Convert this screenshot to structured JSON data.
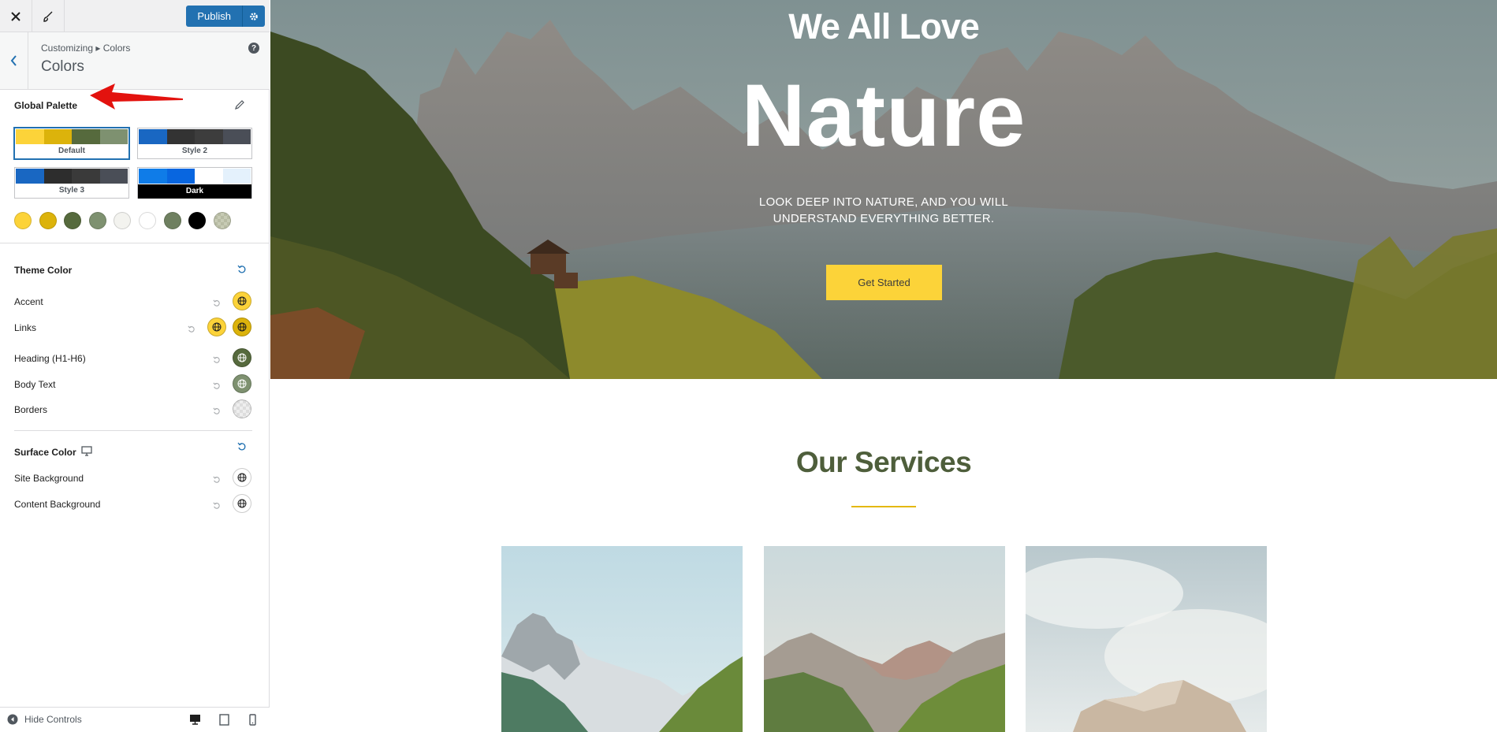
{
  "sidebar": {
    "close_icon": "close-icon",
    "brush_icon": "brush-icon",
    "publish_label": "Publish",
    "breadcrumb": "Customizing ▸ Colors",
    "section_title": "Colors",
    "help_glyph": "?",
    "global_palette_label": "Global Palette",
    "palettes": [
      {
        "name": "Default",
        "colors": [
          "#fcd339",
          "#dcb30b",
          "#566a3d",
          "#7e9170"
        ],
        "active": true
      },
      {
        "name": "Style 2",
        "colors": [
          "#1967c2",
          "#333333",
          "#3d3d3d",
          "#4a4e57"
        ],
        "active": false
      },
      {
        "name": "Style 3",
        "colors": [
          "#1967c2",
          "#2d2d2d",
          "#3a3a3a",
          "#4a4e57"
        ],
        "active": false
      },
      {
        "name": "Dark",
        "colors": [
          "#0f7ce8",
          "#0866e0",
          "#ffffff",
          "#e4f1fc"
        ],
        "active": false
      }
    ],
    "swatches": [
      "#fcd339",
      "#dcb30b",
      "#566a3d",
      "#7e9170",
      "#f3f3ef",
      "#ffffff",
      "#6f8060",
      "#000000",
      "pattern"
    ],
    "theme_color_label": "Theme Color",
    "theme_rows": [
      {
        "label": "Accent",
        "colors": [
          "#fcd339"
        ]
      },
      {
        "label": "Links",
        "colors": [
          "#fcd339",
          "#dcb30b"
        ]
      },
      {
        "label": "Heading (H1-H6)",
        "colors": [
          "#566a3d"
        ]
      },
      {
        "label": "Body Text",
        "colors": [
          "#7e9170"
        ]
      },
      {
        "label": "Borders",
        "colors": [
          "pattern"
        ]
      }
    ],
    "surface_color_label": "Surface Color",
    "surface_rows": [
      {
        "label": "Site Background",
        "colors": [
          "#ffffff"
        ]
      },
      {
        "label": "Content Background",
        "colors": [
          "#ffffff"
        ]
      }
    ],
    "hide_controls_label": "Hide Controls"
  },
  "preview": {
    "hero_title_small": "We All Love",
    "hero_title_big": "Nature",
    "hero_subtitle": "LOOK DEEP INTO NATURE, AND YOU WILL UNDERSTAND EVERYTHING BETTER.",
    "hero_button": "Get Started",
    "services_title": "Our Services"
  },
  "colors": {
    "wp_blue": "#2271b1",
    "accent": "#fcd339",
    "heading": "#4e5e3b",
    "divider_gold": "#e4b810"
  }
}
